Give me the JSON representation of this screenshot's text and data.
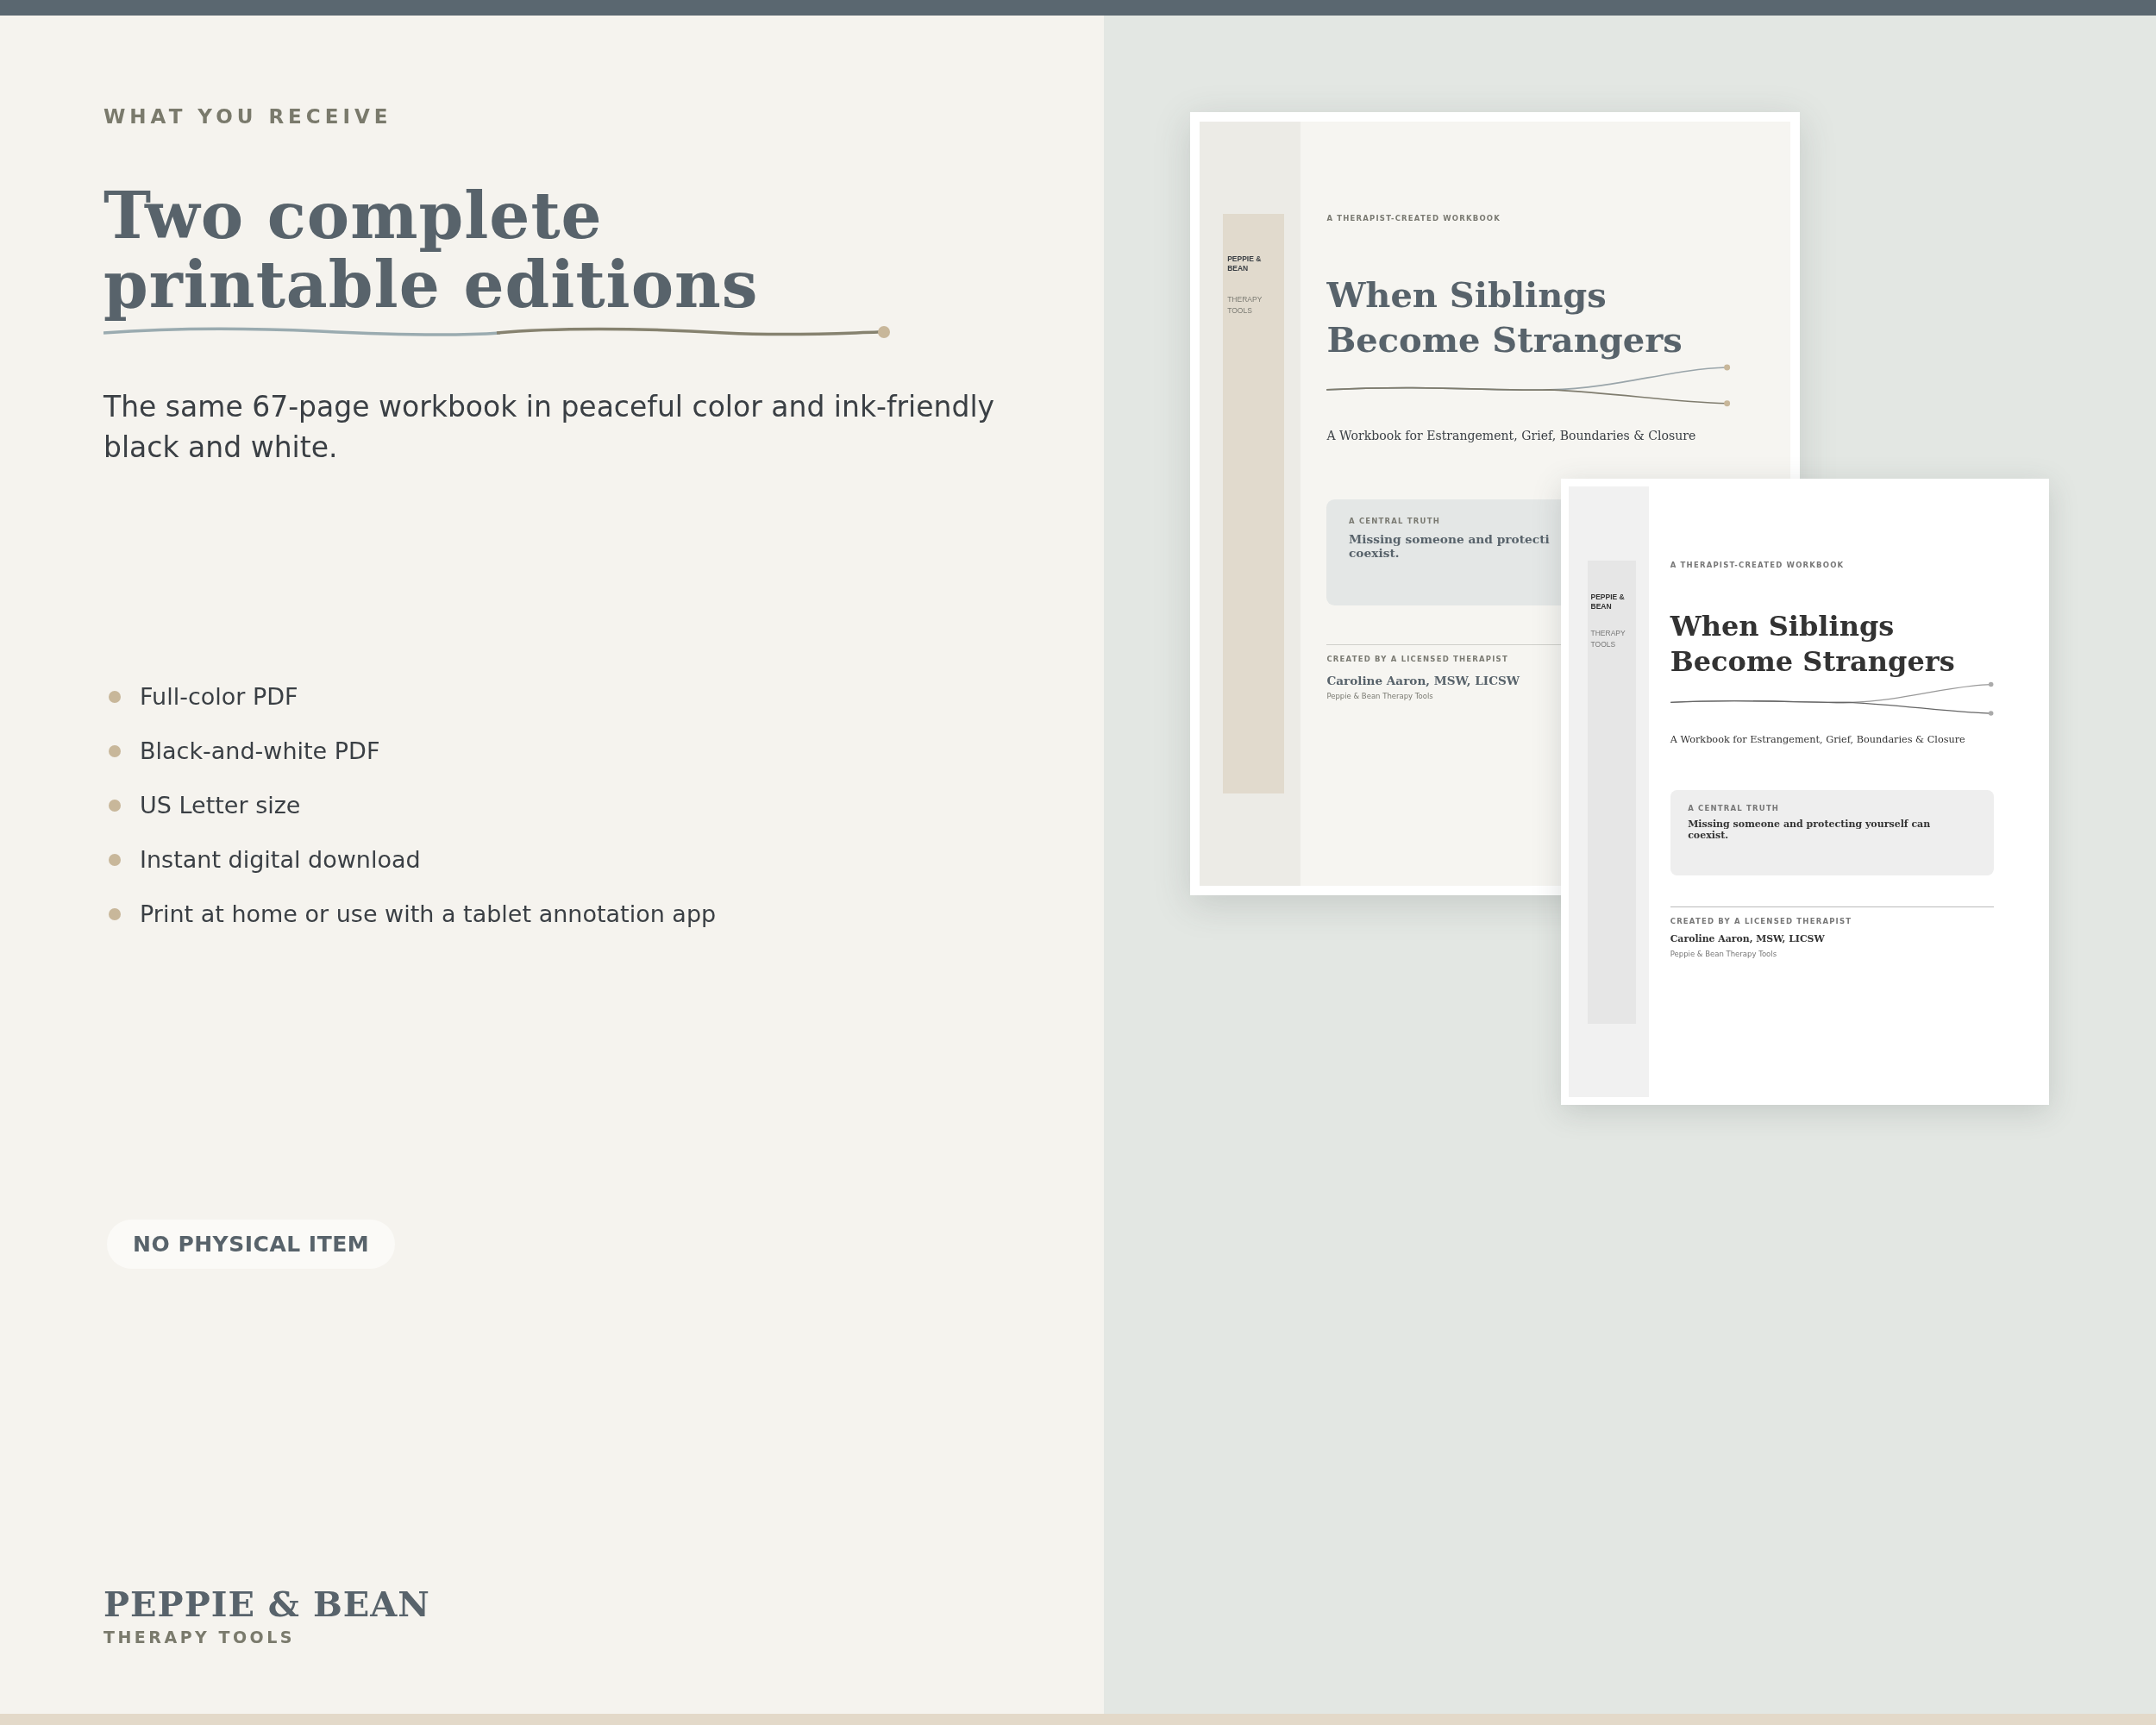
{
  "intro": {
    "eyebrow": "WHAT YOU RECEIVE",
    "heading_lines": [
      "Two complete",
      "printable editions"
    ],
    "description": "The same 67-page workbook in peaceful color and ink-friendly black and white."
  },
  "features": [
    "Full-color PDF",
    "Black-and-white PDF",
    "US Letter size",
    "Instant digital download",
    "Print at home or use with a tablet annotation app"
  ],
  "badge": "NO PHYSICAL ITEM",
  "brand": {
    "name": "PEPPIE & BEAN",
    "tagline": "THERAPY TOOLS"
  },
  "covers": [
    {
      "kind": "color",
      "spine_brand": "PEPPIE & BEAN",
      "spine_tagline": "THERAPY TOOLS",
      "eyebrow": "A THERAPIST-CREATED WORKBOOK",
      "title_lines": [
        "When Siblings",
        "Become Strangers"
      ],
      "subtitle": "A Workbook for Estrangement, Grief, Boundaries & Closure",
      "quote_label": "A CENTRAL TRUTH",
      "quote_lines": [
        "Missing someone and protecti",
        "coexist."
      ],
      "credit_label": "CREATED BY A LICENSED THERAPIST",
      "author": "Caroline Aaron, MSW, LICSW",
      "publisher": "Peppie & Bean Therapy Tools"
    },
    {
      "kind": "bw",
      "spine_brand": "PEPPIE & BEAN",
      "spine_tagline": "THERAPY TOOLS",
      "eyebrow": "A THERAPIST-CREATED WORKBOOK",
      "title_lines": [
        "When Siblings",
        "Become Strangers"
      ],
      "subtitle": "A Workbook for Estrangement, Grief, Boundaries & Closure",
      "quote_label": "A CENTRAL TRUTH",
      "quote_lines": [
        "Missing someone and protecting yourself can",
        "coexist."
      ],
      "credit_label": "CREATED BY A LICENSED THERAPIST",
      "author": "Caroline Aaron, MSW, LICSW",
      "publisher": "Peppie & Bean Therapy Tools"
    }
  ]
}
